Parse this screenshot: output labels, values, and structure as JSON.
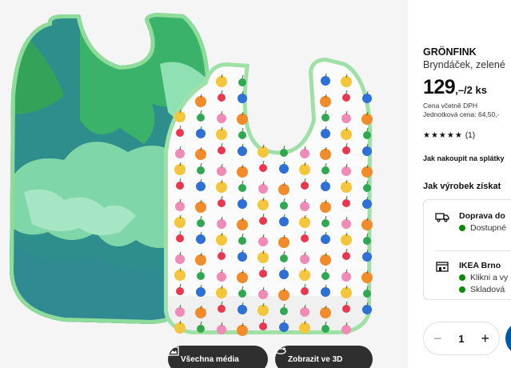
{
  "media": {
    "all_media_label": "Všechna média",
    "view_3d_label": "Zobrazit ve 3D",
    "all_media_icon": "gallery-icon",
    "view_3d_icon": "rotate-3d-icon"
  },
  "product": {
    "name": "GRÖNFINK",
    "description": "Bryndáček, zelené",
    "price_main": "129",
    "price_suffix": ",–/2 ks",
    "vat_note": "Cena včetně DPH",
    "unit_price": "Jednotková cena: 64,50,-",
    "rating_count": "(1)",
    "rating_stars": 5,
    "installment_link": "Jak nakoupit na splátky"
  },
  "availability": {
    "title": "Jak výrobek získat",
    "delivery": {
      "title": "Doprava do",
      "status": "Dostupné",
      "icon": "truck-icon",
      "status_color": "#0a8a00"
    },
    "store": {
      "title": "IKEA Brno",
      "line1": "Klikni a vy",
      "line2": "Skladová",
      "icon": "store-icon",
      "status_color": "#0a8a00"
    }
  },
  "purchase": {
    "quantity": "1",
    "minus": "−",
    "plus": "+",
    "accent": "#0058a3"
  }
}
